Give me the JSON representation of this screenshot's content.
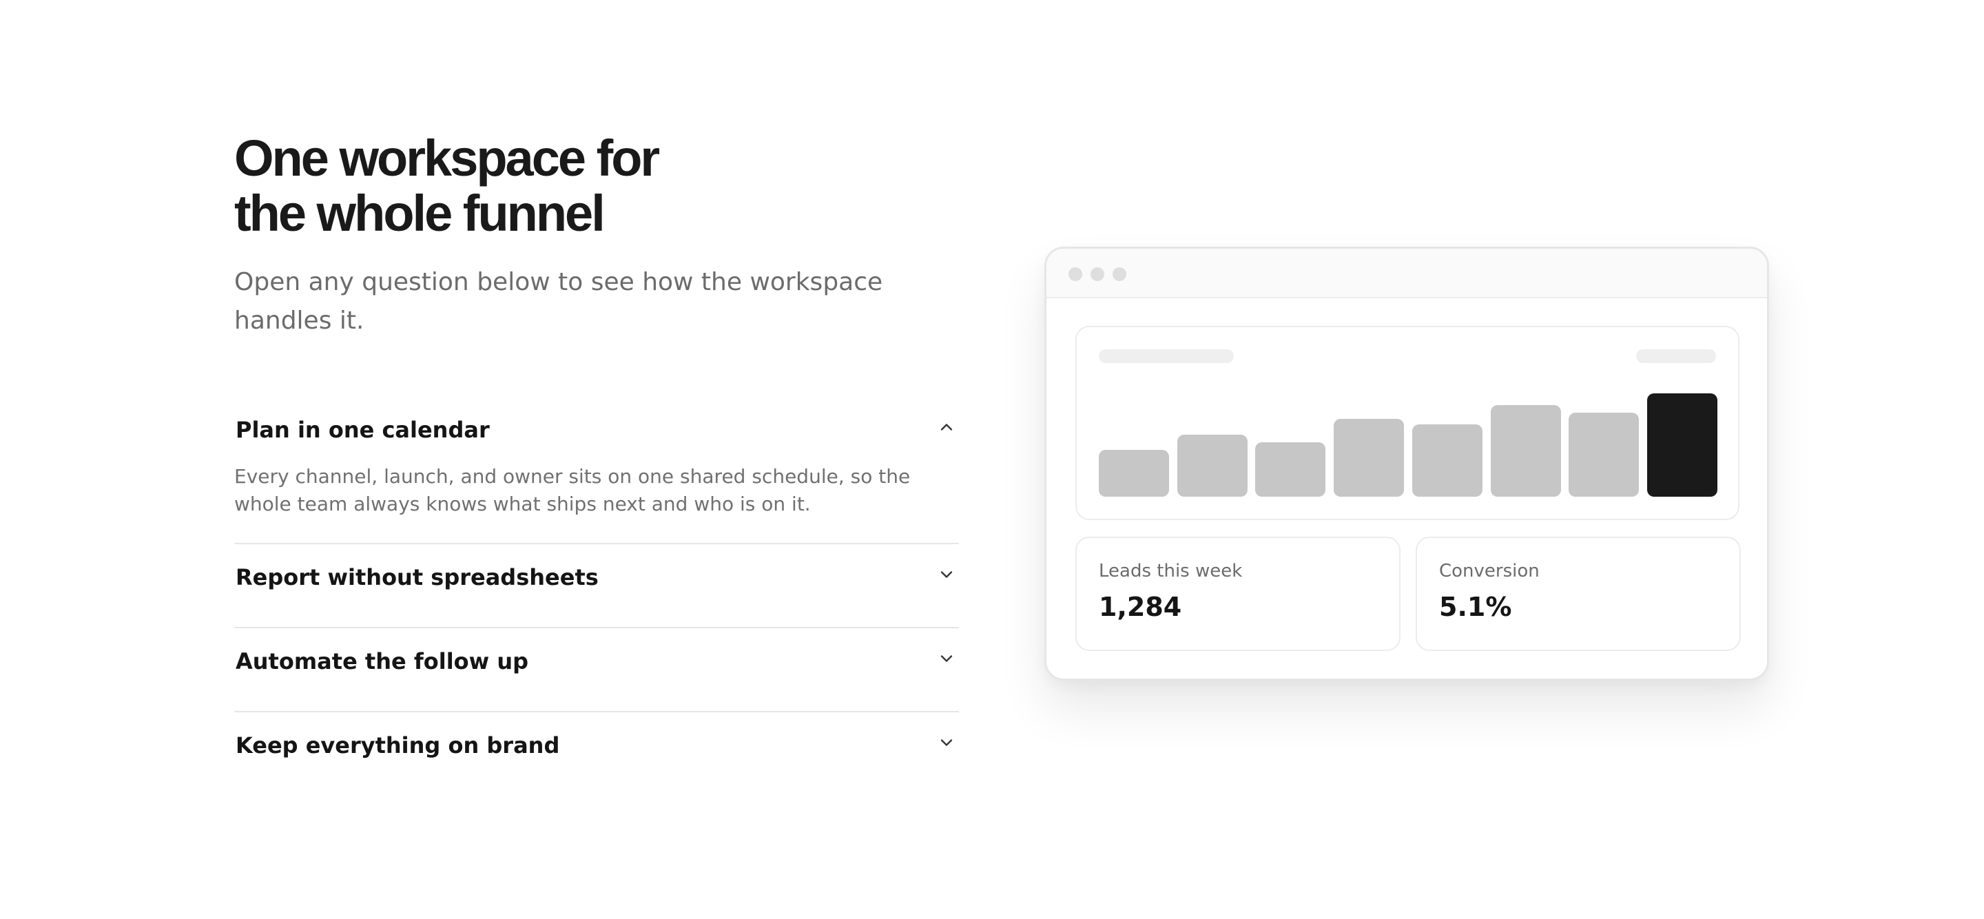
{
  "hero": {
    "title_line1": "One workspace for",
    "title_line2": "the whole funnel",
    "subtitle": "Open any question below to see how the workspace handles it."
  },
  "accordion": {
    "items": [
      {
        "title": "Plan in one calendar",
        "expanded": true,
        "icon": "chevron-up-icon",
        "body": "Every channel, launch, and owner sits on one shared schedule, so the whole team always knows what ships next and who is on it."
      },
      {
        "title": "Report without spreadsheets",
        "expanded": false,
        "icon": "chevron-down-icon"
      },
      {
        "title": "Automate the follow up",
        "expanded": false,
        "icon": "chevron-down-icon"
      },
      {
        "title": "Keep everything on brand",
        "expanded": false,
        "icon": "chevron-down-icon"
      }
    ]
  },
  "preview": {
    "window_controls": [
      "window-dot",
      "window-dot",
      "window-dot"
    ],
    "chart_data": {
      "type": "bar",
      "values": [
        36,
        48,
        42,
        60,
        56,
        71,
        65,
        80
      ],
      "ylim": [
        0,
        80
      ],
      "highlight_index": 7,
      "colors": {
        "default": "#c6c6c6",
        "highlight": "#1a1a1a"
      }
    },
    "stats": [
      {
        "label": "Leads this week",
        "value": "1,284"
      },
      {
        "label": "Conversion",
        "value": "5.1%"
      }
    ]
  },
  "colors": {
    "text_primary": "#1a1a1a",
    "text_secondary": "#6b6b6b",
    "divider": "#e6e6e6",
    "bar": "#c6c6c6",
    "bar_active": "#1a1a1a"
  }
}
